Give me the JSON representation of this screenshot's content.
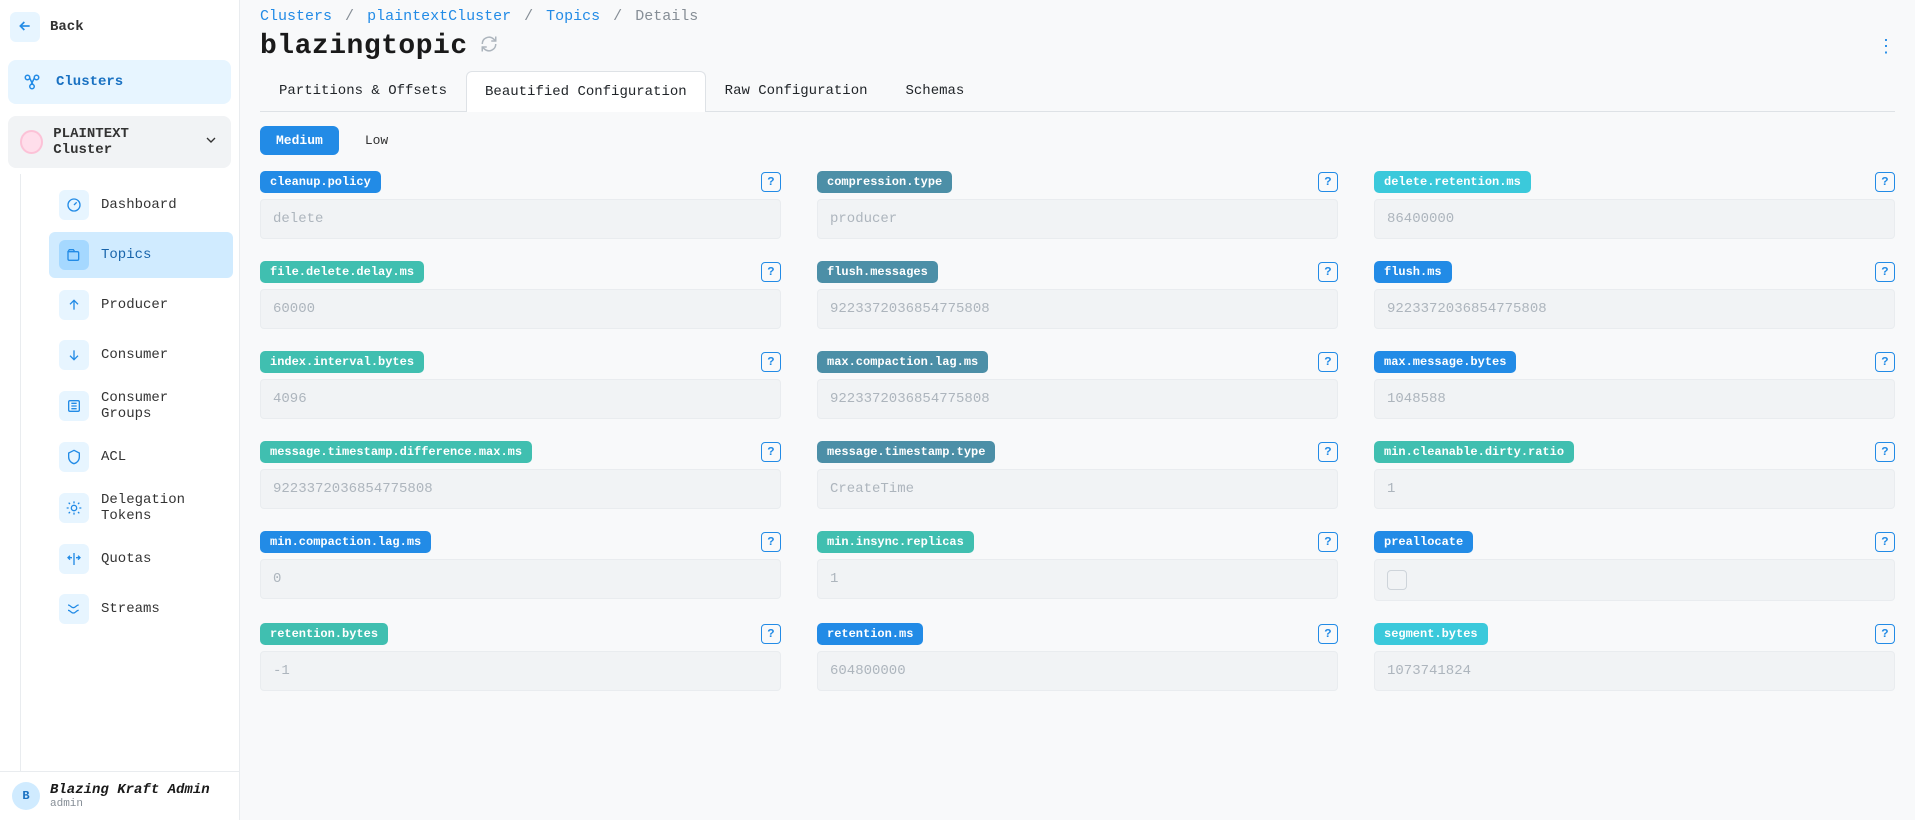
{
  "sidebar": {
    "back_label": "Back",
    "clusters_label": "Clusters",
    "cluster_name": "PLAINTEXT Cluster",
    "nav": [
      {
        "label": "Dashboard",
        "icon": "dashboard-icon"
      },
      {
        "label": "Topics",
        "icon": "topics-icon",
        "active": true
      },
      {
        "label": "Producer",
        "icon": "producer-icon"
      },
      {
        "label": "Consumer",
        "icon": "consumer-icon"
      },
      {
        "label": "Consumer Groups",
        "icon": "groups-icon"
      },
      {
        "label": "ACL",
        "icon": "shield-icon"
      },
      {
        "label": "Delegation Tokens",
        "icon": "tokens-icon"
      },
      {
        "label": "Quotas",
        "icon": "quotas-icon"
      },
      {
        "label": "Streams",
        "icon": "streams-icon"
      }
    ],
    "user": {
      "initial": "B",
      "name": "Blazing Kraft Admin",
      "role": "admin"
    }
  },
  "breadcrumb": {
    "parts": [
      "Clusters",
      "plaintextCluster",
      "Topics"
    ],
    "current": "Details"
  },
  "title": "blazingtopic",
  "tabs": [
    "Partitions & Offsets",
    "Beautified Configuration",
    "Raw Configuration",
    "Schemas"
  ],
  "active_tab": "Beautified Configuration",
  "filters": {
    "medium": "Medium",
    "low": "Low",
    "active": "Medium"
  },
  "badge_colors": {
    "blue": "#228be6",
    "steel": "#4c8fa7",
    "cyan": "#3bc9db",
    "teal": "#40bfb0"
  },
  "configs": [
    {
      "key": "cleanup.policy",
      "value": "delete",
      "color": "blue"
    },
    {
      "key": "compression.type",
      "value": "producer",
      "color": "steel"
    },
    {
      "key": "delete.retention.ms",
      "value": "86400000",
      "color": "cyan"
    },
    {
      "key": "file.delete.delay.ms",
      "value": "60000",
      "color": "teal"
    },
    {
      "key": "flush.messages",
      "value": "9223372036854775808",
      "color": "steel"
    },
    {
      "key": "flush.ms",
      "value": "9223372036854775808",
      "color": "blue"
    },
    {
      "key": "index.interval.bytes",
      "value": "4096",
      "color": "teal"
    },
    {
      "key": "max.compaction.lag.ms",
      "value": "9223372036854775808",
      "color": "steel"
    },
    {
      "key": "max.message.bytes",
      "value": "1048588",
      "color": "blue"
    },
    {
      "key": "message.timestamp.difference.max.ms",
      "value": "9223372036854775808",
      "color": "teal"
    },
    {
      "key": "message.timestamp.type",
      "value": "CreateTime",
      "color": "steel"
    },
    {
      "key": "min.cleanable.dirty.ratio",
      "value": "1",
      "color": "teal"
    },
    {
      "key": "min.compaction.lag.ms",
      "value": "0",
      "color": "blue"
    },
    {
      "key": "min.insync.replicas",
      "value": "1",
      "color": "teal"
    },
    {
      "key": "preallocate",
      "value": "",
      "color": "blue",
      "type": "checkbox"
    },
    {
      "key": "retention.bytes",
      "value": "-1",
      "color": "teal"
    },
    {
      "key": "retention.ms",
      "value": "604800000",
      "color": "blue"
    },
    {
      "key": "segment.bytes",
      "value": "1073741824",
      "color": "cyan"
    }
  ]
}
